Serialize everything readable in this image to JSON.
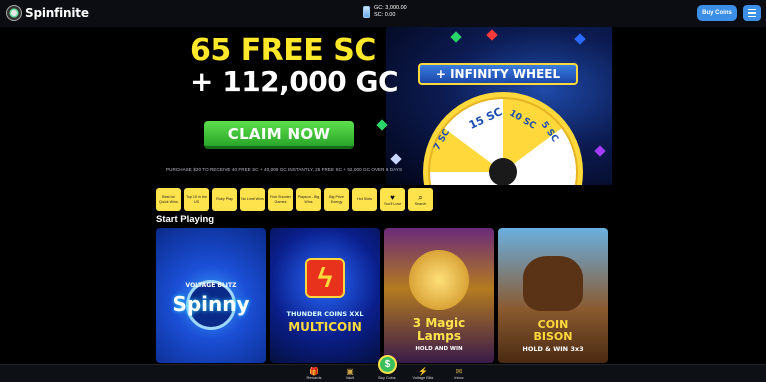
{
  "header": {
    "brand": "Spinfinite",
    "gc_balance": "GC: 3,000.00",
    "sc_balance": "SC: 0.00",
    "buy_coins_label": "Buy Coins"
  },
  "banner": {
    "headline_line1": "65 FREE SC",
    "headline_line2": "+ 112,000 GC",
    "claim_label": "CLAIM NOW",
    "fine_print": "PURCHASE $20 TO RECEIVE 40 FREE SC + 40,000 GC INSTANTLY, 25 FREE SC + 52,000 GC OVER 6 DAYS",
    "wheel_title": "+ INFINITY WHEEL",
    "wheel_segments": [
      "15 SC",
      "10 SC",
      "5 SC",
      "7 SC"
    ]
  },
  "categories": [
    {
      "label": "Best for Quick Wins",
      "icon": ""
    },
    {
      "label": "Top 10 in the US",
      "icon": ""
    },
    {
      "label": "Ruby Play",
      "icon": ""
    },
    {
      "label": "No Limit Wins",
      "icon": ""
    },
    {
      "label": "Fish Shooter Games",
      "icon": ""
    },
    {
      "label": "Playson - Big Wins",
      "icon": ""
    },
    {
      "label": "Big Prize Energy",
      "icon": ""
    },
    {
      "label": "Hot Slots",
      "icon": ""
    },
    {
      "label": "You'll Love",
      "icon": "heart-icon"
    },
    {
      "label": "Search",
      "icon": "search-icon"
    }
  ],
  "section_title": "Start Playing",
  "games": [
    {
      "brand": "VOLTAGE BLITZ",
      "title": "Spinny",
      "colors": [
        "#1b4fd6",
        "#0a2a8a"
      ]
    },
    {
      "brand": "THUNDER COINS XXL",
      "title": "MULTICOIN",
      "colors": [
        "#0a1f8c",
        "#081250"
      ]
    },
    {
      "brand": "3 Magic",
      "title": "Lamps",
      "subtitle": "HOLD AND WIN",
      "colors": [
        "#b47b20",
        "#5a2a6a"
      ]
    },
    {
      "brand": "COIN",
      "title": "BISON",
      "subtitle": "HOLD & WIN 3x3",
      "colors": [
        "#4aa0d8",
        "#7a4a2a"
      ]
    }
  ],
  "bottom_nav": {
    "rewards": "Rewards",
    "vault": "Vault",
    "buy_coins": "Buy Coins",
    "voltage_blitz": "Voltage Blitz",
    "inbox": "Inbox"
  },
  "colors": {
    "accent_blue": "#3b8fe6",
    "category_yellow": "#ffe34d",
    "claim_green": "#3fc43c"
  }
}
